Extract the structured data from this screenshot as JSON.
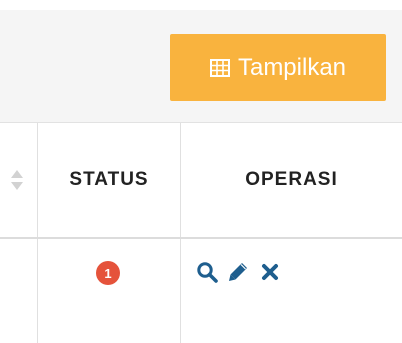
{
  "toolbar": {
    "show_button_label": "Tampilkan",
    "show_button_icon": "table-icon",
    "button_color": "#f9b33e"
  },
  "table": {
    "columns": [
      "STATUS",
      "OPERASI"
    ],
    "rows": [
      {
        "status_badge": "1",
        "status_color": "#e5533b",
        "actions": [
          "search-icon",
          "pencil-icon",
          "close-icon"
        ]
      }
    ]
  },
  "colors": {
    "action_icon": "#1e5e8e"
  }
}
